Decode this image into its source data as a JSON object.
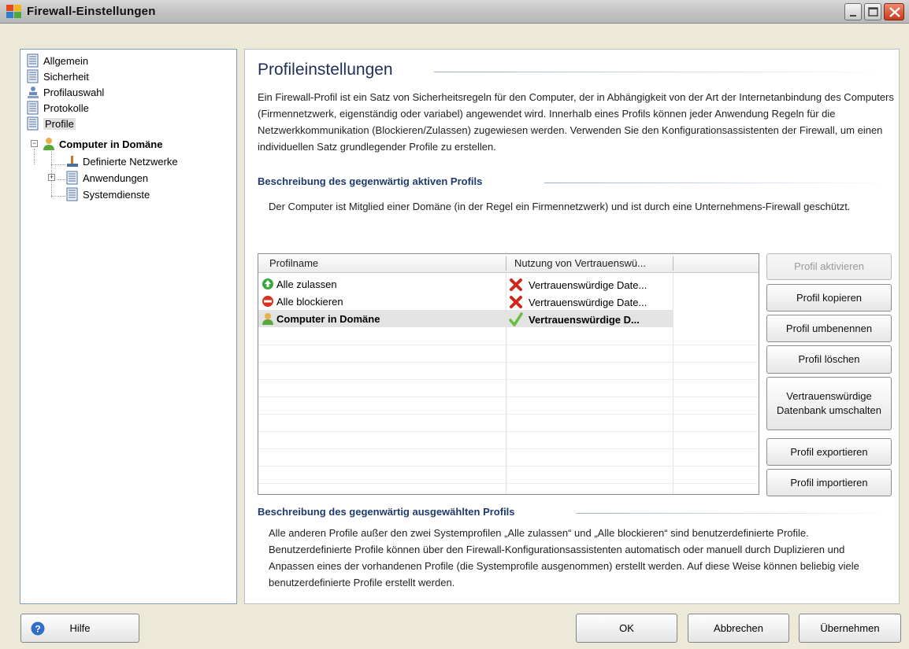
{
  "window": {
    "title": "Firewall-Einstellungen"
  },
  "tree": {
    "items": [
      {
        "label": "Allgemein"
      },
      {
        "label": "Sicherheit"
      },
      {
        "label": "Profilauswahl"
      },
      {
        "label": "Protokolle"
      },
      {
        "label": "Profile"
      },
      {
        "label": "Computer in Domäne"
      },
      {
        "label": "Definierte Netzwerke"
      },
      {
        "label": "Anwendungen"
      },
      {
        "label": "Systemdienste"
      }
    ]
  },
  "main": {
    "title": "Profileinstellungen",
    "intro": "Ein Firewall-Profil ist ein Satz von Sicherheitsregeln für den Computer, der in Abhängigkeit von der Art der Internetanbindung des Computers (Firmennetzwerk, eigenständig oder variabel) angewendet wird. Innerhalb eines Profils können jeder Anwendung Regeln für die Netzwerkkommunikation (Blockieren/Zulassen) zugewiesen werden. Verwenden Sie den Konfigurationsassistenten der Firewall, um einen individuellen Satz grundlegender Profile zu erstellen.",
    "active_heading": "Beschreibung des gegenwärtig aktiven Profils",
    "active_text": "Der Computer ist Mitglied einer Domäne (in der Regel ein Firmennetzwerk) und ist durch eine Unternehmens-Firewall geschützt.",
    "selected_heading": "Beschreibung des gegenwärtig ausgewählten Profils",
    "selected_text": "Alle anderen Profile außer den zwei Systemprofilen „Alle zulassen“ und „Alle blockieren“ sind benutzerdefinierte Profile. Benutzerdefinierte Profile können über den Firewall-Konfigurationsassistenten automatisch oder manuell durch Duplizieren und Anpassen eines der vorhandenen Profile (die Systemprofile ausgenommen) erstellt werden. Auf diese Weise können beliebig viele benutzerdefinierte Profile erstellt werden."
  },
  "grid": {
    "columns": [
      "Profilname",
      "Nutzung von Vertrauenswü..."
    ],
    "rows": [
      {
        "name": "Alle zulassen",
        "name_icon": "allow-icon",
        "trust": "Vertrauenswürdige Date...",
        "trust_icon": "red-x-icon"
      },
      {
        "name": "Alle blockieren",
        "name_icon": "block-icon",
        "trust": "Vertrauenswürdige Date...",
        "trust_icon": "red-x-icon"
      },
      {
        "name": "Computer in Domäne",
        "name_icon": "user-icon",
        "trust": "Vertrauenswürdige D...",
        "trust_icon": "green-check-icon"
      }
    ]
  },
  "actions": {
    "activate": "Profil aktivieren",
    "copy": "Profil kopieren",
    "rename": "Profil umbenennen",
    "delete": "Profil löschen",
    "toggle_db_line1": "Vertrauenswürdige",
    "toggle_db_line2": "Datenbank umschalten",
    "export": "Profil exportieren",
    "import": "Profil importieren"
  },
  "footer": {
    "help": "Hilfe",
    "ok": "OK",
    "cancel": "Abbrechen",
    "apply": "Übernehmen"
  },
  "colors": {
    "title_blue": "#1f2f57",
    "heading_blue": "#1f3a6e",
    "close_red": "#c8391c",
    "selected_row": "#e3e3e3"
  }
}
